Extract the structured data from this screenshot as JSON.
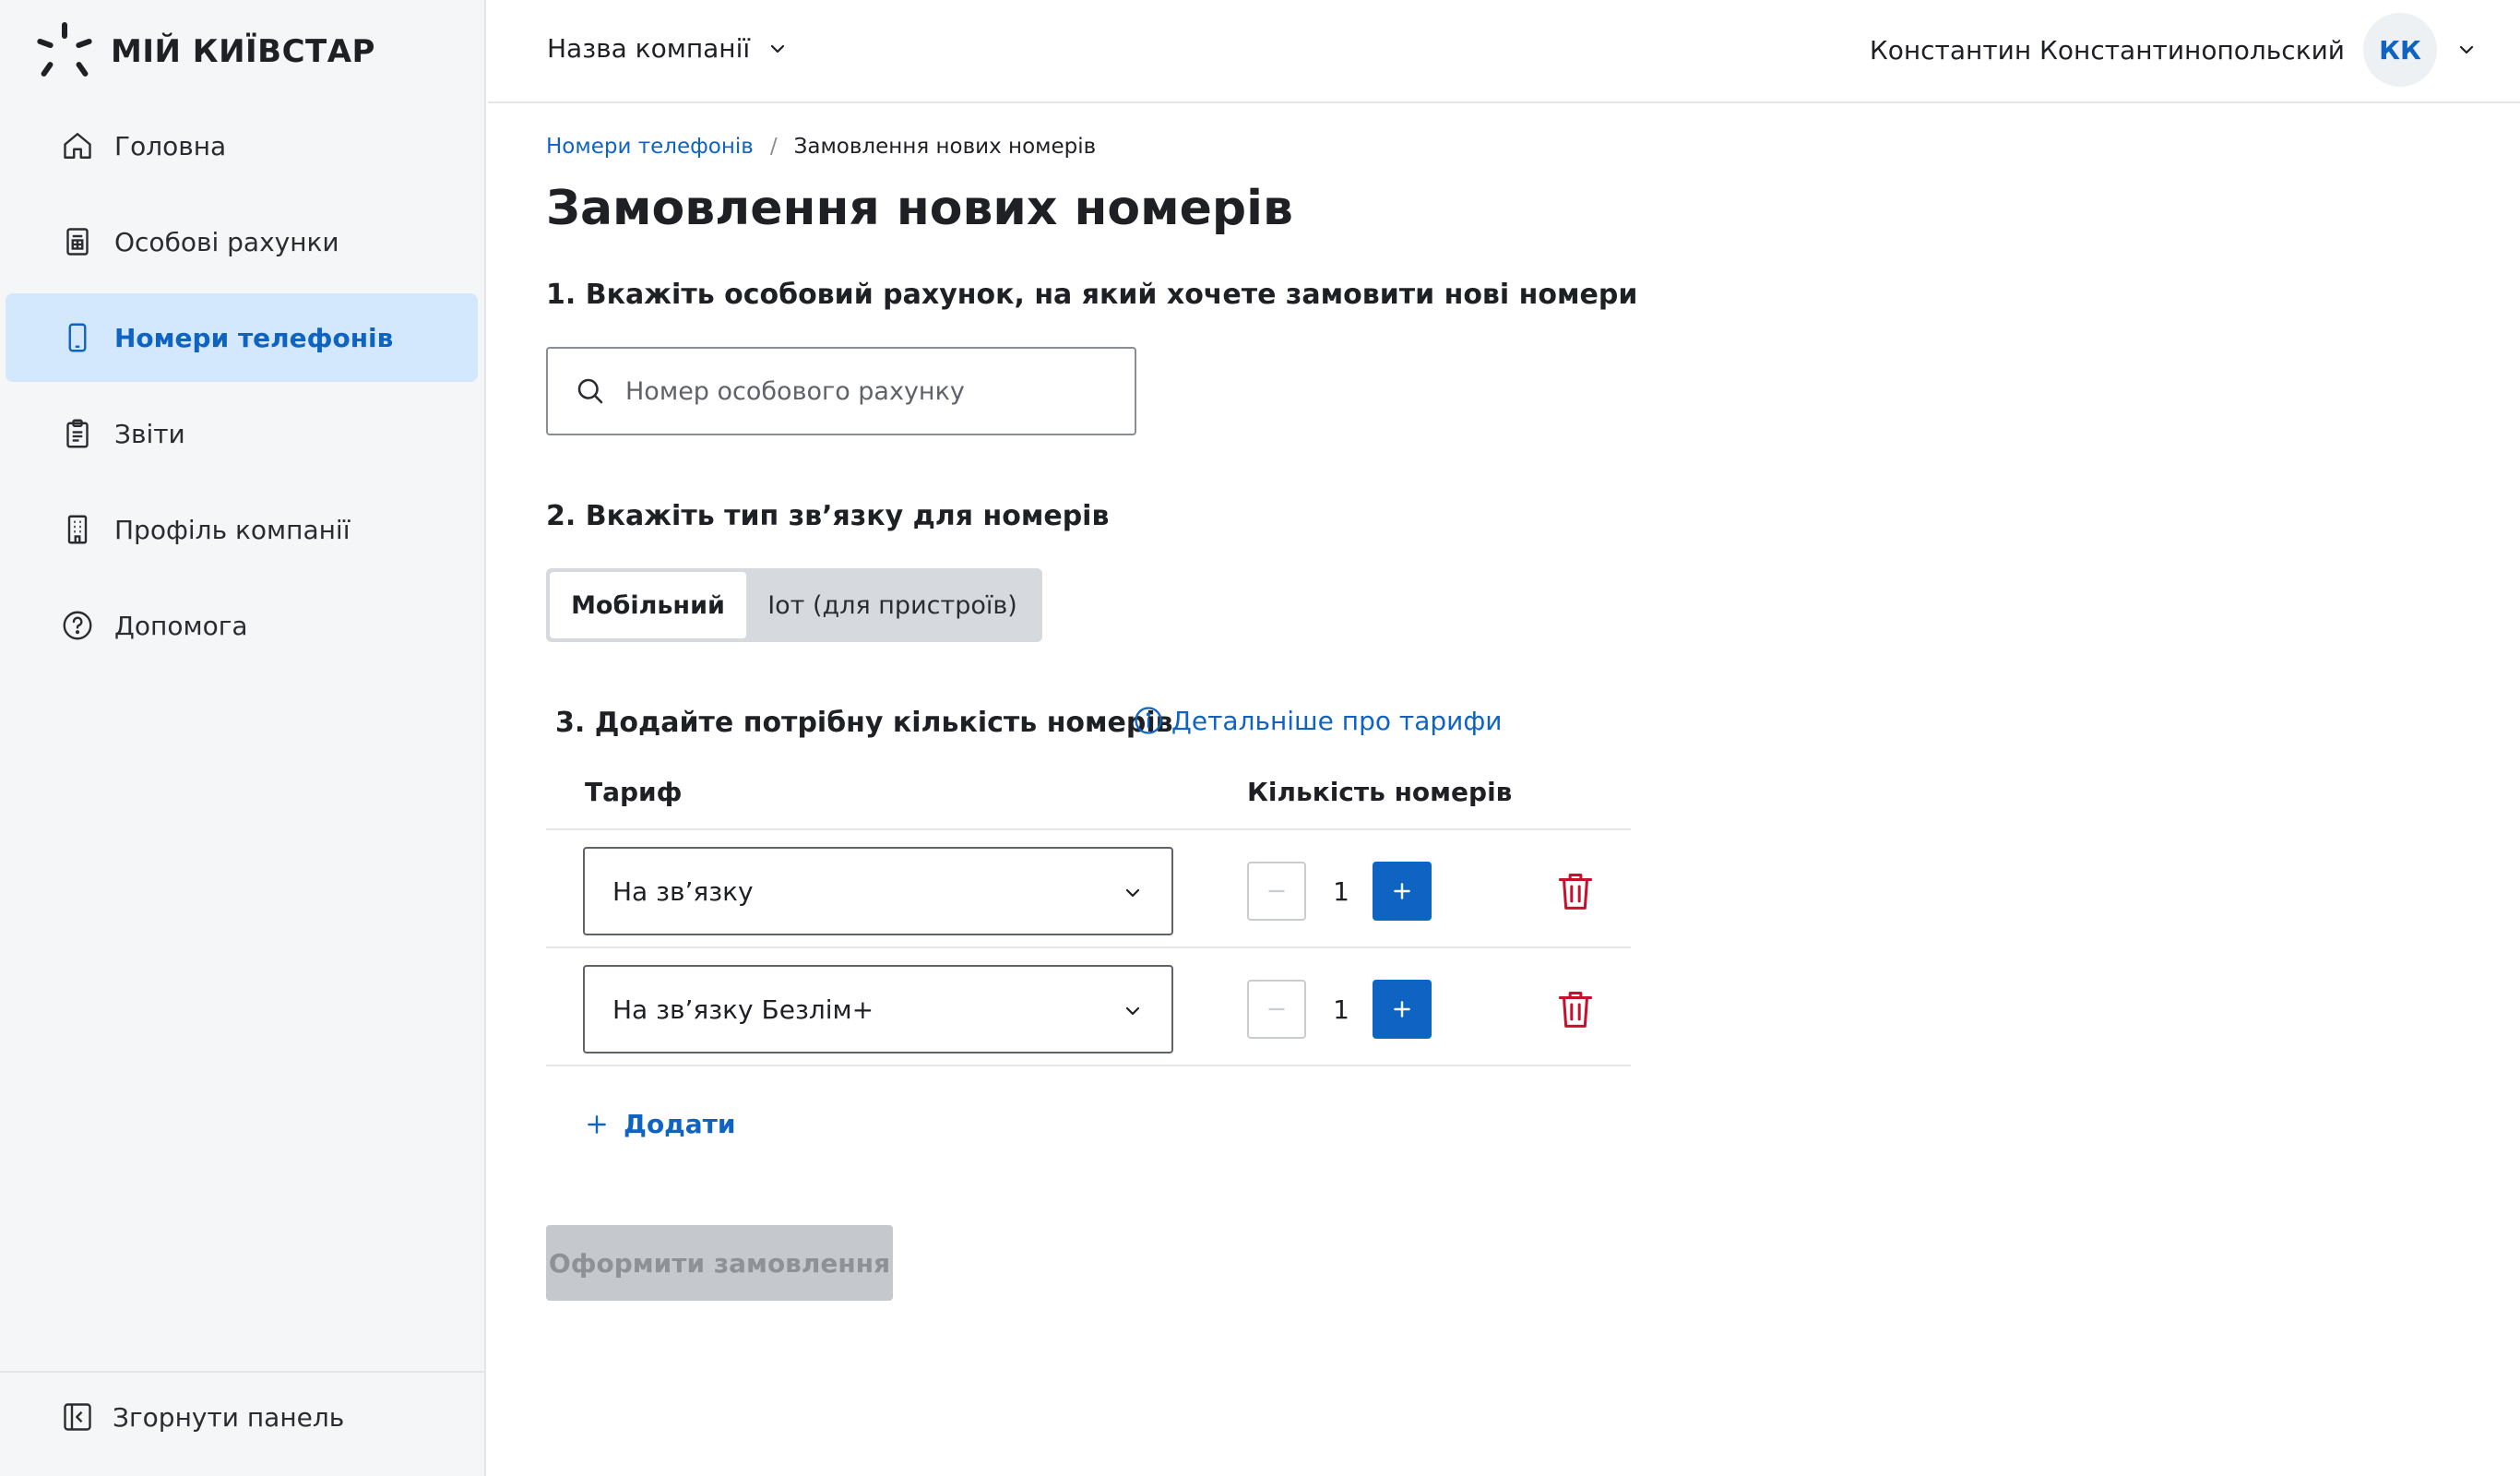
{
  "brand": {
    "logo_text": "МІЙ КИЇВСТАР",
    "accent_color": "#0f64c3",
    "active_nav_bg": "#d3e8fc",
    "danger_color": "#c8102e"
  },
  "sidebar": {
    "items": [
      {
        "label": "Головна",
        "icon": "home-icon",
        "active": false
      },
      {
        "label": "Особові рахунки",
        "icon": "document-icon",
        "active": false
      },
      {
        "label": "Номери телефонів",
        "icon": "phone-icon",
        "active": true
      },
      {
        "label": "Звіти",
        "icon": "clipboard-icon",
        "active": false
      },
      {
        "label": "Профіль компанії",
        "icon": "building-icon",
        "active": false
      },
      {
        "label": "Допомога",
        "icon": "help-icon",
        "active": false
      }
    ],
    "collapse_label": "Згорнути панель"
  },
  "header": {
    "company_name": "Назва компанії",
    "user_name": "Константин Константинопольский",
    "user_initials": "КК"
  },
  "breadcrumb": {
    "parent": "Номери телефонів",
    "separator": "/",
    "current": "Замовлення нових номерів"
  },
  "page": {
    "title": "Замовлення нових номерів",
    "step1_title": "1. Вкажіть особовий рахунок, на який хочете замовити нові номери",
    "search_placeholder": "Номер особового рахунку",
    "step2_title": "2. Вкажіть тип зв’язку для номерів",
    "connection_types": [
      "Мобільний",
      "Іот (для пристроїв)"
    ],
    "selected_connection_type": "Мобільний",
    "step3_title": "3. Додайте потрібну кількість номерів",
    "details_link": "Детальніше про тарифи"
  },
  "table": {
    "col_tariff": "Тариф",
    "col_quantity": "Кількість номерів",
    "rows": [
      {
        "tariff": "На зв’язку",
        "quantity": "1"
      },
      {
        "tariff": "На зв’язку Безлім+",
        "quantity": "1"
      }
    ]
  },
  "actions": {
    "add_label": "Додати",
    "submit_label": "Оформити замовлення",
    "submit_disabled": true
  }
}
